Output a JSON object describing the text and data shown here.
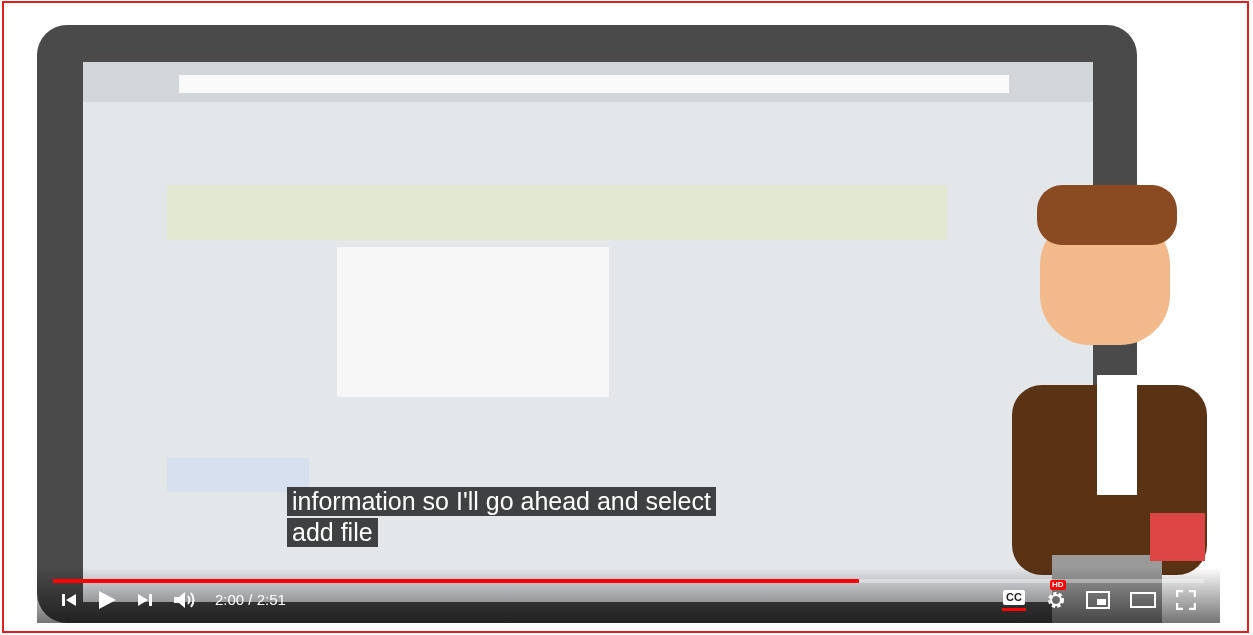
{
  "captions": [
    "information so I'll go ahead and select",
    "add file"
  ],
  "progress": {
    "level": 0.7
  },
  "time": "2:00 / 2:51",
  "cc": {
    "label": "CC",
    "on": true
  },
  "settings": {
    "badge": "HD"
  }
}
